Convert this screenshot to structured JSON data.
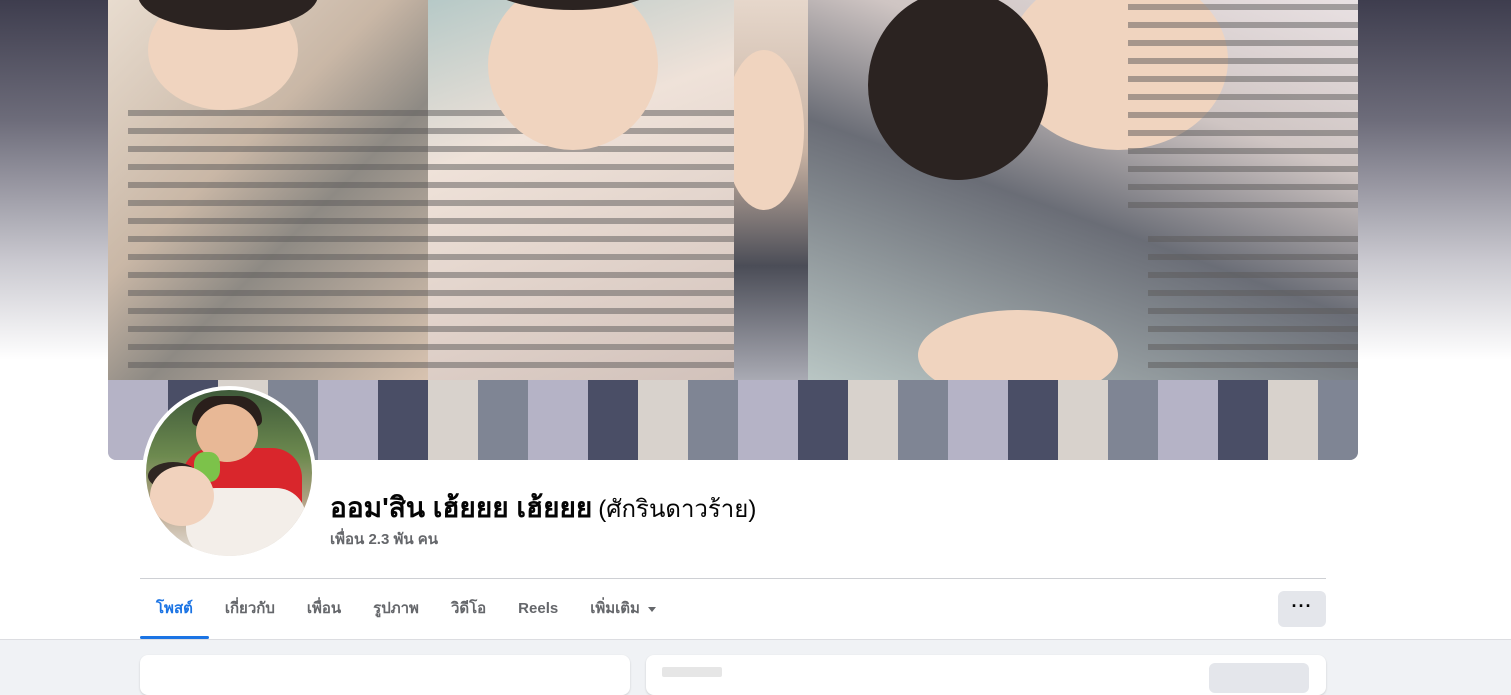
{
  "profile": {
    "name": "ออม'สิน เฮ้ยยย เฮ้ยยย",
    "alternate_name": "(ศักรินดาวร้าย)",
    "friends_count": "เพื่อน 2.3 พัน คน"
  },
  "tabs": [
    {
      "label": "โพสต์",
      "active": true
    },
    {
      "label": "เกี่ยวกับ",
      "active": false
    },
    {
      "label": "เพื่อน",
      "active": false
    },
    {
      "label": "รูปภาพ",
      "active": false
    },
    {
      "label": "วิดีโอ",
      "active": false
    },
    {
      "label": "Reels",
      "active": false
    },
    {
      "label": "เพิ่มเติม",
      "active": false
    }
  ],
  "more_button": {
    "icon": "more-horizontal-icon",
    "glyph": "···"
  },
  "colors": {
    "accent": "#1b74e4",
    "text_primary": "#050505",
    "text_secondary": "#65676b",
    "button_bg": "#e4e6eb",
    "page_bg": "#f0f2f5"
  }
}
